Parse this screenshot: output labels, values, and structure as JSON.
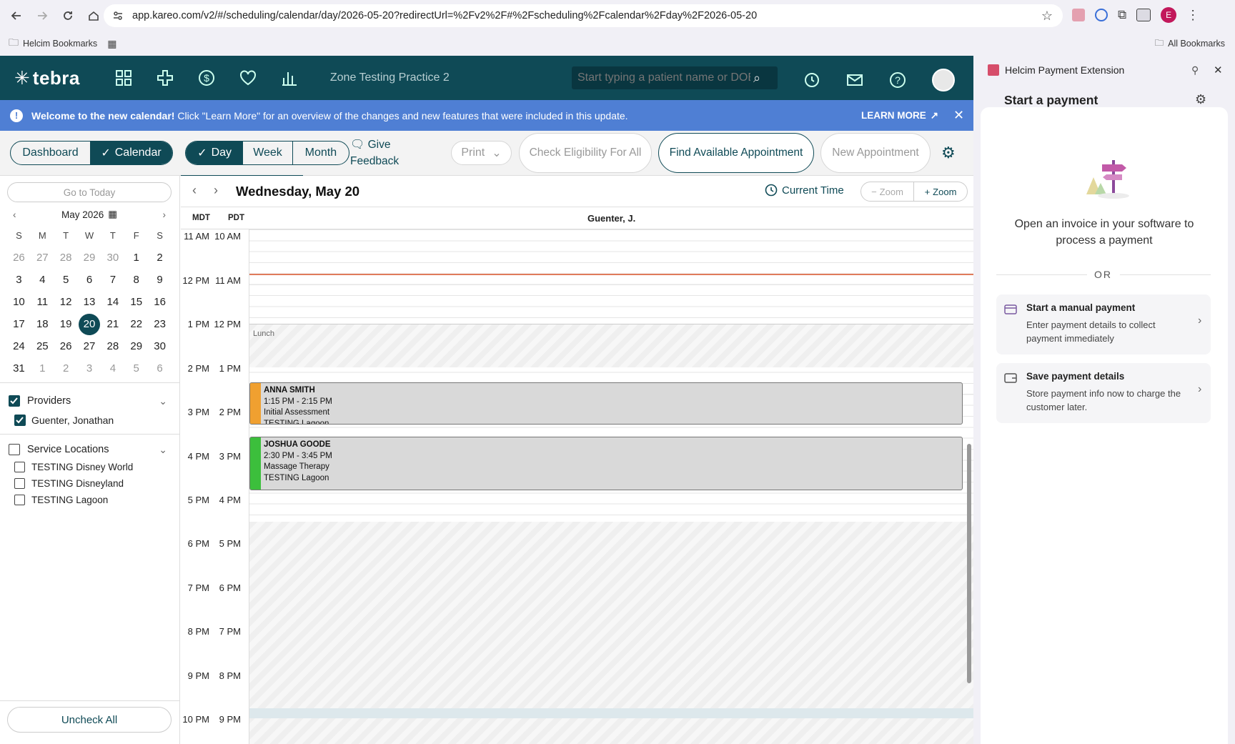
{
  "browser": {
    "url": "app.kareo.com/v2/#/scheduling/calendar/day/2026-05-20?redirectUrl=%2Fv2%2F#%2Fscheduling%2Fcalendar%2Fday%2F2026-05-20",
    "bookmark_folder": "Helcim Bookmarks",
    "all_bookmarks": "All Bookmarks",
    "profile_initial": "E"
  },
  "app": {
    "logo": "tebra",
    "practice": "Zone Testing Practice 2",
    "search_placeholder": "Start typing a patient name or DOB"
  },
  "banner": {
    "title": "Welcome to the new calendar!",
    "text": " Click \"Learn More\" for an overview of the changes and new features that were included in this update.",
    "learn_more": "LEARN MORE"
  },
  "toolbar": {
    "dashboard": "Dashboard",
    "calendar": "Calendar",
    "day": "Day",
    "week": "Week",
    "month": "Month",
    "feedback": "Give Feedback",
    "print": "Print",
    "check_eligibility": "Check Eligibility For All",
    "find_appt": "Find Available Appointment",
    "new_appt": "New Appointment"
  },
  "sidebar": {
    "go_today": "Go to Today",
    "month_label": "May 2026",
    "weekdays": [
      "S",
      "M",
      "T",
      "W",
      "T",
      "F",
      "S"
    ],
    "weeks": [
      [
        "26",
        "27",
        "28",
        "29",
        "30",
        "1",
        "2"
      ],
      [
        "3",
        "4",
        "5",
        "6",
        "7",
        "8",
        "9"
      ],
      [
        "10",
        "11",
        "12",
        "13",
        "14",
        "15",
        "16"
      ],
      [
        "17",
        "18",
        "19",
        "20",
        "21",
        "22",
        "23"
      ],
      [
        "24",
        "25",
        "26",
        "27",
        "28",
        "29",
        "30"
      ],
      [
        "31",
        "1",
        "2",
        "3",
        "4",
        "5",
        "6"
      ]
    ],
    "selected_day": "20",
    "providers_label": "Providers",
    "provider": "Guenter, Jonathan",
    "locations_label": "Service Locations",
    "locations": [
      "TESTING Disney World",
      "TESTING Disneyland",
      "TESTING Lagoon"
    ],
    "uncheck_all": "Uncheck All"
  },
  "calendar": {
    "date_title": "Wednesday, May 20",
    "current_time": "Current Time",
    "zoom_out": "Zoom",
    "zoom_in": "Zoom",
    "tz1": "MDT",
    "tz2": "PDT",
    "provider_col": "Guenter, J.",
    "times_mdt": [
      "11 AM",
      "12 PM",
      "1 PM",
      "2 PM",
      "3 PM",
      "4 PM",
      "5 PM",
      "6 PM",
      "7 PM",
      "8 PM",
      "9 PM",
      "10 PM"
    ],
    "times_pdt": [
      "10 AM",
      "11 AM",
      "12 PM",
      "1 PM",
      "2 PM",
      "3 PM",
      "4 PM",
      "5 PM",
      "6 PM",
      "7 PM",
      "8 PM",
      "9 PM"
    ],
    "lunch": "Lunch",
    "appointments": [
      {
        "name": "ANNA SMITH",
        "time": "1:15 PM - 2:15 PM",
        "type": "Initial Assessment",
        "location": "TESTING Lagoon",
        "color": "#f0a030"
      },
      {
        "name": "JOSHUA GOODE",
        "time": "2:30 PM - 3:45 PM",
        "type": "Massage Therapy",
        "location": "TESTING Lagoon",
        "color": "#3cbf3c"
      }
    ]
  },
  "extension": {
    "title": "Helcim Payment Extension",
    "heading": "Start a payment",
    "message": "Open an invoice in your software to process a payment",
    "or": "OR",
    "manual_title": "Start a manual payment",
    "manual_desc": "Enter payment details to collect payment immediately",
    "save_title": "Save payment details",
    "save_desc": "Store payment info now to charge the customer later."
  }
}
